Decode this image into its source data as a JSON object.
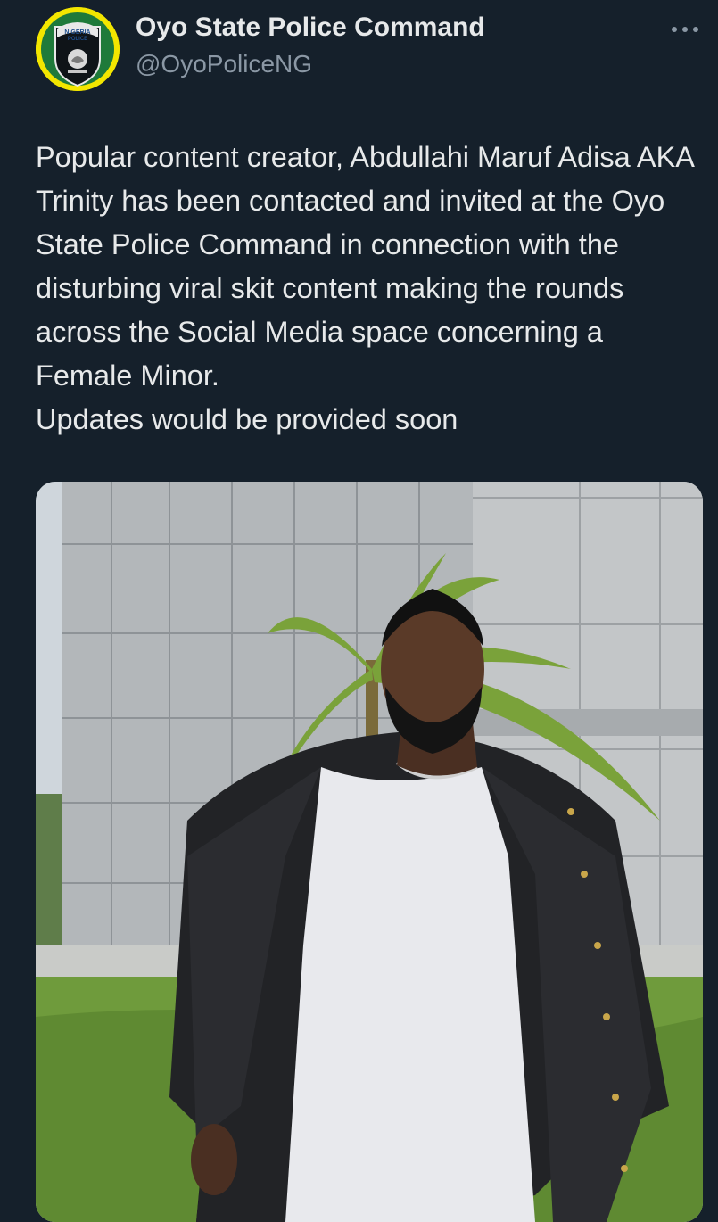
{
  "tweet": {
    "author_name": "Oyo State Police Command",
    "author_handle": "@OyoPoliceNG",
    "avatar_badge_text": "NIGERIA POLICE",
    "avatar_icon": "nigeria-police-badge",
    "more_icon": "more-options-icon",
    "text": "Popular content creator, Abdullahi Maruf Adisa AKA Trinity has been contacted and invited at the Oyo State Police Command in connection with the disturbing viral skit content making the rounds across the Social Media space concerning a Female Minor.\nUpdates would be provided soon"
  },
  "colors": {
    "background": "#15202b",
    "primary_text": "#e7e9ea",
    "secondary_text": "#8b98a5",
    "badge_yellow": "#f3e600",
    "badge_green": "#1f7a3a"
  }
}
